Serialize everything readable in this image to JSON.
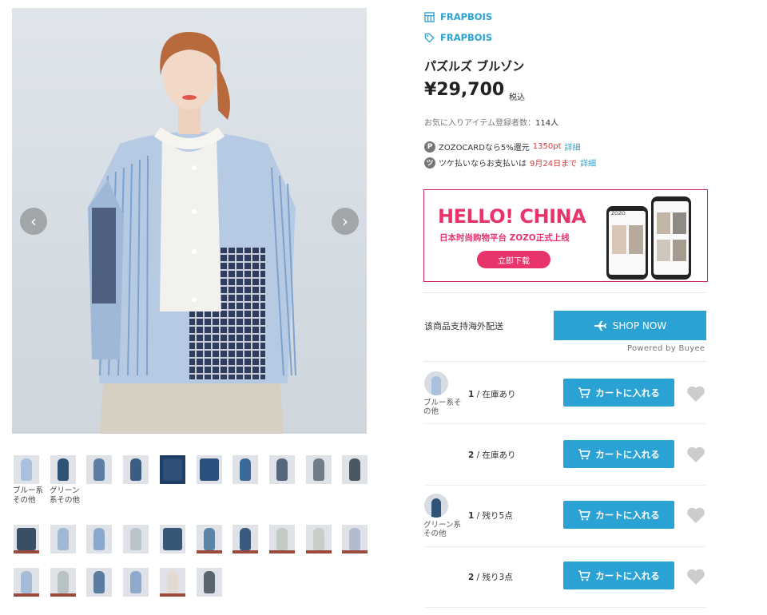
{
  "gallery": {
    "prev": "‹",
    "next": "›",
    "captions": [
      "ブルー系その他",
      "グリーン系その他"
    ]
  },
  "brand": {
    "shop": "FRAPBOIS",
    "tag": "FRAPBOIS"
  },
  "product": {
    "title": "パズルズ ブルゾン",
    "price": "¥29,700",
    "tax": "税込",
    "fav_label": "お気に入りアイテム登録者数：",
    "fav_count": "114人"
  },
  "payments": {
    "zozocard_pre": "ZOZOCARDなら5%還元",
    "zozocard_pts": "1350pt",
    "zozocard_link": "詳細",
    "tsuke_pre": "ツケ払いならお支払いは",
    "tsuke_date": "9月24日まで",
    "tsuke_link": "詳細"
  },
  "banner": {
    "headline": "HELLO! CHINA",
    "sub": "日本时尚购物平台 ZOZO正式上线",
    "button": "立即下载",
    "app_logo": "ZOZO"
  },
  "shipping": {
    "text": "该商品支持海外配送",
    "button": "SHOP NOW",
    "powered": "Powered by Buyee"
  },
  "variants": [
    {
      "color": "ブルー系その他",
      "size": "1",
      "stock": "在庫あり",
      "cart": "カートに入れる"
    },
    {
      "color": "",
      "size": "2",
      "stock": "在庫あり",
      "cart": "カートに入れる"
    },
    {
      "color": "グリーン系その他",
      "size": "1",
      "stock": "残り5点",
      "cart": "カートに入れる"
    },
    {
      "color": "",
      "size": "2",
      "stock": "残り3点",
      "cart": "カートに入れる"
    }
  ],
  "colors": {
    "accent": "#2aa3d4",
    "banner": "#e8336b",
    "heart": "#cccccc"
  }
}
